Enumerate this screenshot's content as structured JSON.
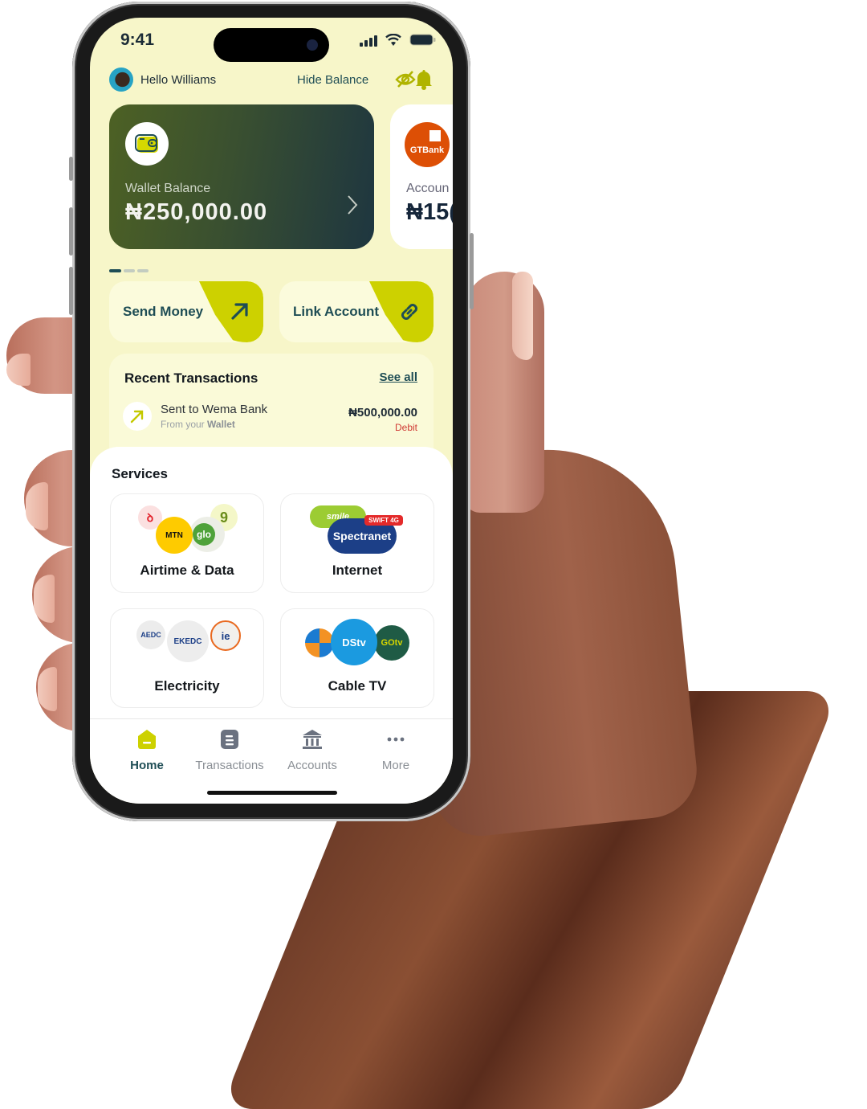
{
  "status_bar": {
    "time": "9:41"
  },
  "header": {
    "greeting": "Hello Williams",
    "hide_balance_label": "Hide Balance",
    "icons": [
      "avatar",
      "eye-off-icon",
      "bell-icon"
    ]
  },
  "balance_cards": [
    {
      "label": "Wallet Balance",
      "amount": "₦250,000.00",
      "icon": "wallet-icon"
    },
    {
      "label": "Accoun",
      "amount": "₦15(",
      "bank": "GTBank"
    }
  ],
  "carousel": {
    "pages": 3,
    "active_index": 0
  },
  "quick_actions": [
    {
      "label": "Send Money",
      "icon": "arrow-up-right-icon"
    },
    {
      "label": "Link Account",
      "icon": "link-icon"
    }
  ],
  "recent_transactions": {
    "title": "Recent Transactions",
    "see_all": "See all",
    "items": [
      {
        "title": "Sent to Wema Bank",
        "sub_prefix": "From your",
        "sub_source": "Wallet",
        "amount": "₦500,000.00",
        "type": "Debit"
      }
    ]
  },
  "services": {
    "title": "Services",
    "items": [
      {
        "label": "Airtime & Data",
        "logos": [
          "Airtel",
          "MTN",
          "glo",
          "9mobile"
        ]
      },
      {
        "label": "Internet",
        "logos": [
          "smile",
          "SWIFT 4G",
          "Spectranet"
        ]
      },
      {
        "label": "Electricity",
        "logos": [
          "AEDC",
          "EKEDC",
          "IE"
        ]
      },
      {
        "label": "Cable TV",
        "logos": [
          "Startimes",
          "DStv",
          "GOtv"
        ]
      }
    ]
  },
  "tab_bar": {
    "active": "Home",
    "tabs": [
      {
        "label": "Home",
        "icon": "home-icon"
      },
      {
        "label": "Transactions",
        "icon": "document-icon"
      },
      {
        "label": "Accounts",
        "icon": "bank-icon"
      },
      {
        "label": "More",
        "icon": "more-icon"
      }
    ]
  },
  "colors": {
    "background": "#f7f6c9",
    "accent": "#cdd100",
    "primary_text": "#1e4d55",
    "debit": "#cf3a34"
  }
}
